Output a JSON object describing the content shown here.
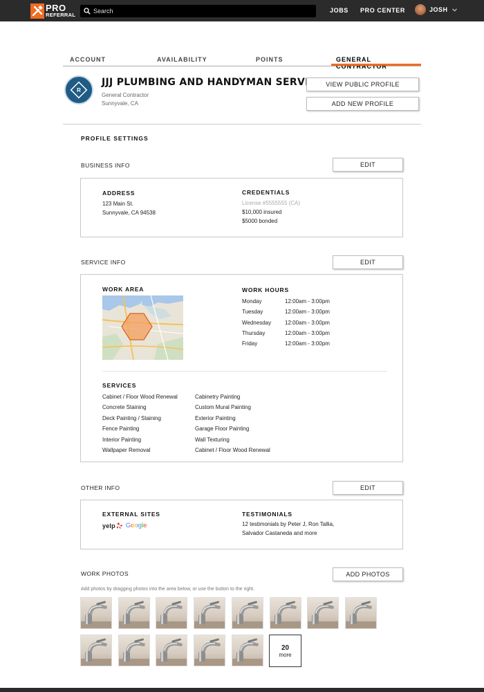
{
  "brand": {
    "logo_line1": "PRO",
    "logo_line2": "REFERRAL",
    "accent": "#f26b21",
    "bar_color": "#2b2b2b"
  },
  "search": {
    "placeholder": "Search"
  },
  "nav": {
    "jobs": "JOBS",
    "pro_center": "PRO CENTER",
    "user": "JOSH"
  },
  "tabs": [
    {
      "label": "ACCOUNT"
    },
    {
      "label": "AVAILABILITY"
    },
    {
      "label": "POINTS"
    },
    {
      "label": "GENERAL CONTRACTOR",
      "active": true
    }
  ],
  "profile": {
    "name": "JJJ PLUMBING AND HANDYMAN SERVICES",
    "role": "General Contractor",
    "location": "Sunnyvale, CA",
    "view_public_label": "VIEW PUBLIC PROFILE",
    "add_new_label": "ADD NEW PROFILE"
  },
  "settings_title": "PROFILE SETTINGS",
  "business": {
    "label": "BUSINESS INFO",
    "edit_label": "EDIT",
    "address_h": "ADDRESS",
    "address_line1": "123 Main St.",
    "address_line2": "Sunnyvale, CA 94538",
    "credentials_h": "CREDENTIALS",
    "license": "License #5555555 (CA)",
    "insured": "$10,000 insured",
    "bonded": "$5000 bonded"
  },
  "service": {
    "label": "SERVICE INFO",
    "edit_label": "EDIT",
    "work_area_h": "WORK AREA",
    "work_hours_h": "WORK HOURS",
    "hours": [
      {
        "day": "Monday",
        "time": "12:00am - 3:00pm"
      },
      {
        "day": "Tuesday",
        "time": "12:00am - 3:00pm"
      },
      {
        "day": "Wednesday",
        "time": "12:00am - 3:00pm"
      },
      {
        "day": "Thursday",
        "time": "12:00am - 3:00pm"
      },
      {
        "day": "Friday",
        "time": "12:00am - 3:00pm"
      }
    ],
    "services_h": "SERVICES",
    "services_col1": [
      "Cabinet / Floor Wood Renewal",
      "Concrete Staining",
      "Deck Painting / Staining",
      "Fence Painting",
      "Interior Painting",
      "Wallpaper Removal"
    ],
    "services_col2": [
      "Cabinetry Painting",
      "Custom Mural Painting",
      "Exterior Painting",
      "Garage Floor Painting",
      "Wall Texturing",
      "Cabinet / Floor Wood Renewal"
    ]
  },
  "other": {
    "label": "OTHER INFO",
    "edit_label": "EDIT",
    "external_h": "EXTERNAL SITES",
    "yelp": "yelp",
    "google": "Google",
    "testimonials_h": "TESTIMONIALS",
    "testimonials_line1": "12 testimonials by Peter J, Ron Tallia,",
    "testimonials_line2": "Salvador Castaneda and more"
  },
  "photos": {
    "label": "WORK PHOTOS",
    "add_label": "ADD PHOTOS",
    "hint": "Add photos by dragging photos into the area below, or use the button to the right.",
    "more_count": "20",
    "more_label": "more"
  }
}
